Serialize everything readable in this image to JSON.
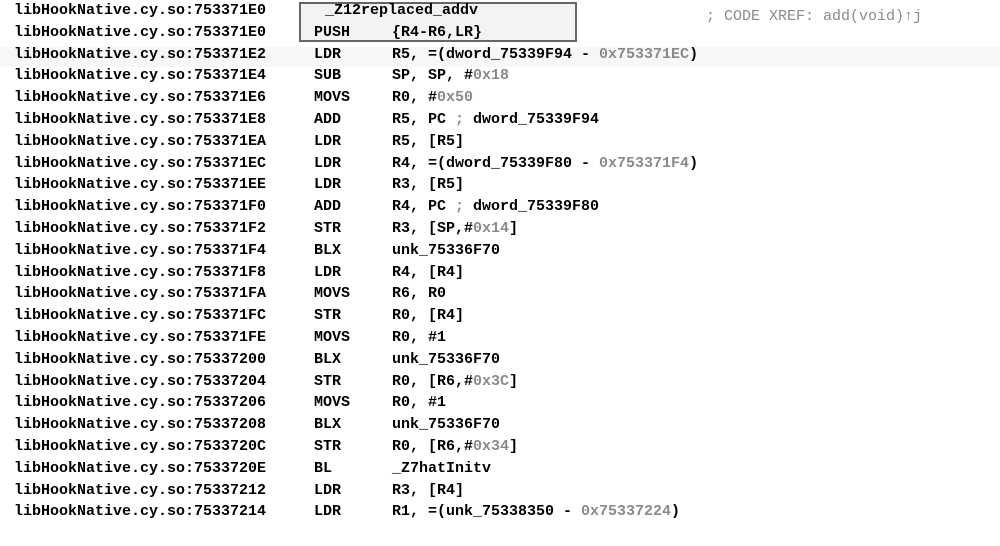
{
  "module": "libHookNative.cy.so",
  "highlight_symbol": "_Z12replaced_addv",
  "xref": "; CODE XREF: add(void)↑j",
  "rows": [
    {
      "addr": "753371E0",
      "mnemonic": "",
      "ops": "_Z12replaced_addv",
      "dim": false
    },
    {
      "addr": "753371E0",
      "mnemonic": "PUSH",
      "ops": "{R4-R6,LR}",
      "dim": false
    },
    {
      "addr": "753371E2",
      "mnemonic": "LDR",
      "ops": "R5, =(dword_75339F94 - 0x753371EC)",
      "dim": false
    },
    {
      "addr": "753371E4",
      "mnemonic": "SUB",
      "ops": "SP, SP, #0x18",
      "dim": false
    },
    {
      "addr": "753371E6",
      "mnemonic": "MOVS",
      "ops": "R0, #0x50",
      "dim": false
    },
    {
      "addr": "753371E8",
      "mnemonic": "ADD",
      "ops": "R5, PC ; dword_75339F94",
      "dim": false
    },
    {
      "addr": "753371EA",
      "mnemonic": "LDR",
      "ops": "R5, [R5]",
      "dim": false
    },
    {
      "addr": "753371EC",
      "mnemonic": "LDR",
      "ops": "R4, =(dword_75339F80 - 0x753371F4)",
      "dim": false
    },
    {
      "addr": "753371EE",
      "mnemonic": "LDR",
      "ops": "R3, [R5]",
      "dim": false
    },
    {
      "addr": "753371F0",
      "mnemonic": "ADD",
      "ops": "R4, PC ; dword_75339F80",
      "dim": false
    },
    {
      "addr": "753371F2",
      "mnemonic": "STR",
      "ops": "R3, [SP,#0x14]",
      "dim": false
    },
    {
      "addr": "753371F4",
      "mnemonic": "BLX",
      "ops": "unk_75336F70",
      "dim": false
    },
    {
      "addr": "753371F8",
      "mnemonic": "LDR",
      "ops": "R4, [R4]",
      "dim": false
    },
    {
      "addr": "753371FA",
      "mnemonic": "MOVS",
      "ops": "R6, R0",
      "dim": false
    },
    {
      "addr": "753371FC",
      "mnemonic": "STR",
      "ops": "R0, [R4]",
      "dim": false
    },
    {
      "addr": "753371FE",
      "mnemonic": "MOVS",
      "ops": "R0, #1",
      "dim": false
    },
    {
      "addr": "75337200",
      "mnemonic": "BLX",
      "ops": "unk_75336F70",
      "dim": false
    },
    {
      "addr": "75337204",
      "mnemonic": "STR",
      "ops": "R0, [R6,#0x3C]",
      "dim": false
    },
    {
      "addr": "75337206",
      "mnemonic": "MOVS",
      "ops": "R0, #1",
      "dim": false
    },
    {
      "addr": "75337208",
      "mnemonic": "BLX",
      "ops": "unk_75336F70",
      "dim": false
    },
    {
      "addr": "7533720C",
      "mnemonic": "STR",
      "ops": "R0, [R6,#0x34]",
      "dim": false
    },
    {
      "addr": "7533720E",
      "mnemonic": "BL",
      "ops": "_Z7hatInitv",
      "dim": false
    },
    {
      "addr": "75337212",
      "mnemonic": "LDR",
      "ops": "R3, [R4]",
      "dim": false
    },
    {
      "addr": "75337214",
      "mnemonic": "LDR",
      "ops": "R1, =(unk_75338350 - 0x75337224)",
      "dim": false
    }
  ],
  "dim_top_row": {
    "addr_partial": "753371E0",
    "text_partial": "libHookNative.cy.so:753371E0"
  }
}
